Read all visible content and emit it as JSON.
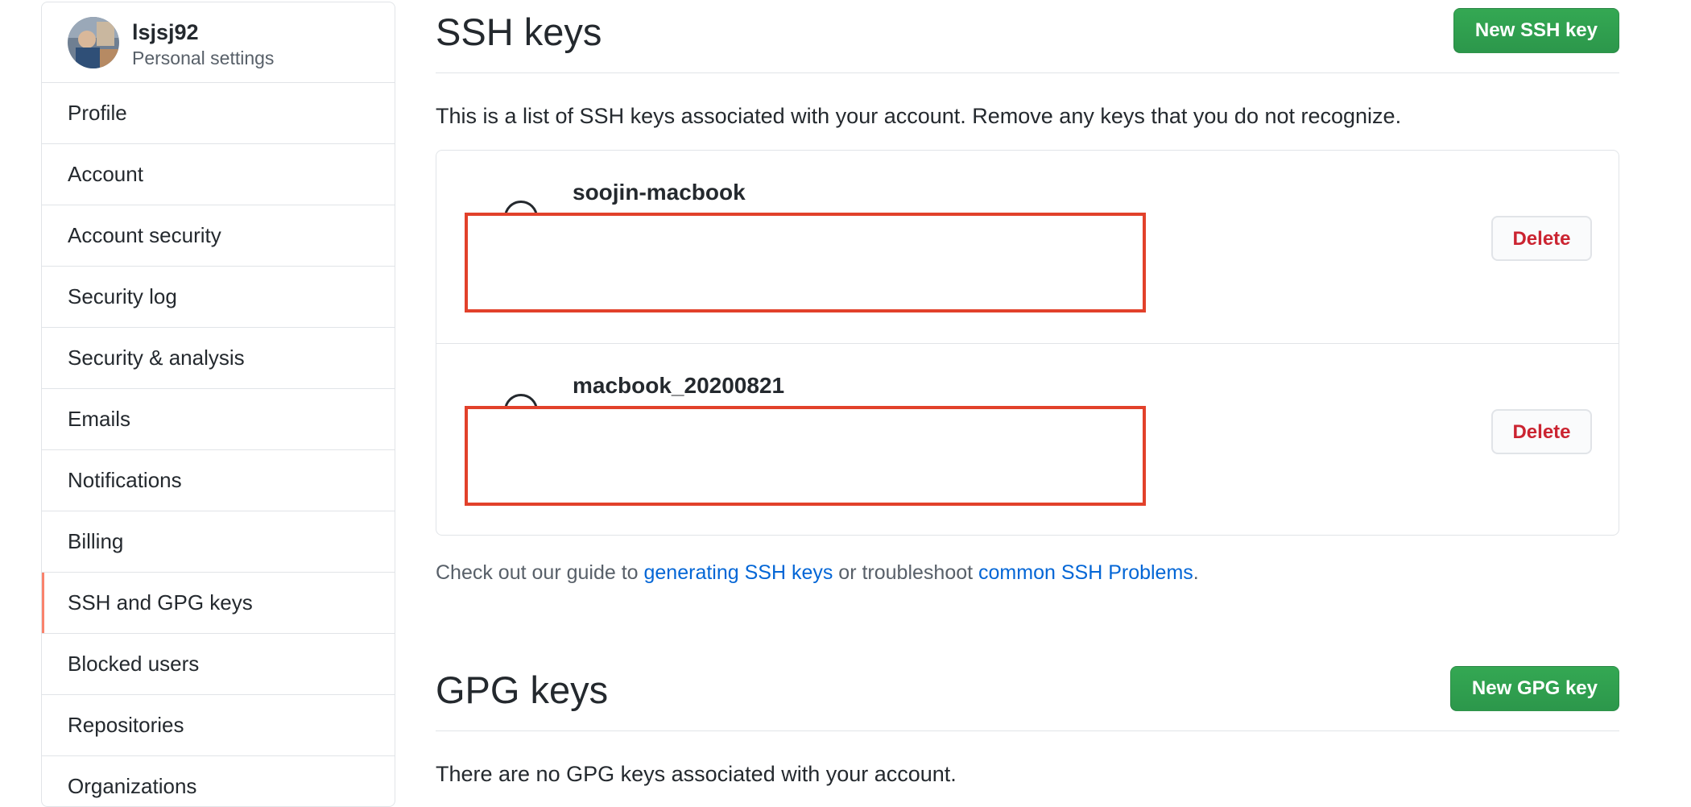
{
  "sidebar": {
    "user": {
      "name": "lsjsj92",
      "subtitle": "Personal settings"
    },
    "items": [
      {
        "label": "Profile"
      },
      {
        "label": "Account"
      },
      {
        "label": "Account security"
      },
      {
        "label": "Security log"
      },
      {
        "label": "Security & analysis"
      },
      {
        "label": "Emails"
      },
      {
        "label": "Notifications"
      },
      {
        "label": "Billing"
      },
      {
        "label": "SSH and GPG keys",
        "selected": true
      },
      {
        "label": "Blocked users"
      },
      {
        "label": "Repositories"
      },
      {
        "label": "Organizations"
      }
    ]
  },
  "ssh": {
    "title": "SSH keys",
    "new_button": "New SSH key",
    "description": "This is a list of SSH keys associated with your account. Remove any keys that you do not recognize.",
    "keys": [
      {
        "name": "soojin-macbook",
        "icon": "key-icon",
        "delete_label": "Delete"
      },
      {
        "name": "macbook_20200821",
        "icon": "key-icon",
        "delete_label": "Delete"
      }
    ],
    "help": {
      "prefix": "Check out our guide to ",
      "link1": "generating SSH keys",
      "middle": " or troubleshoot ",
      "link2": "common SSH Problems",
      "suffix": "."
    }
  },
  "gpg": {
    "title": "GPG keys",
    "new_button": "New GPG key",
    "empty_text": "There are no GPG keys associated with your account."
  },
  "colors": {
    "accent_selected": "#f9826c",
    "primary_button": "#2ea44f",
    "danger": "#cb2431",
    "link": "#0366d6",
    "redaction_border": "#e2412b"
  }
}
